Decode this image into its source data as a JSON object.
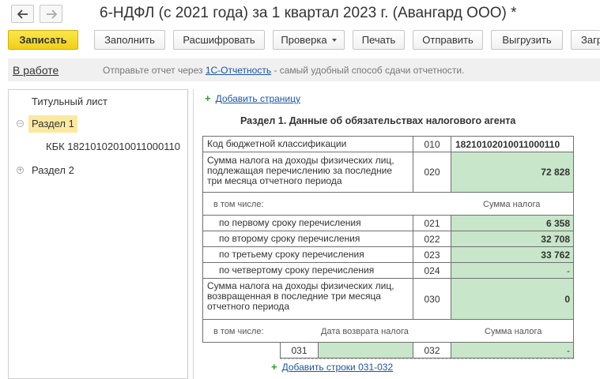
{
  "window": {
    "title": "6-НДФЛ (с 2021 года) за 1 квартал 2023 г. (Авангард ООО) *",
    "back_icon": "arrow-left-icon",
    "forward_icon": "arrow-right-icon"
  },
  "toolbar": {
    "save": "Записать",
    "fill": "Заполнить",
    "decode": "Расшифровать",
    "check": "Проверка",
    "print": "Печать",
    "send": "Отправить",
    "export": "Выгрузить",
    "load": "Загр"
  },
  "status": {
    "state": "В работе",
    "msg_before": "Отправьте отчет через ",
    "msg_link": "1С-Отчетность",
    "msg_after": " - самый удобный способ сдачи отчетности."
  },
  "tree": {
    "title_sheet": "Титульный лист",
    "section1": "Раздел 1",
    "kbk_item": "КБК 18210102010011000110",
    "section2": "Раздел 2"
  },
  "form": {
    "add_page": "Добавить страницу",
    "section_title": "Раздел 1. Данные об обязательствах налогового агента",
    "rows": {
      "kbk_label": "Код бюджетной классификации",
      "kbk_code": "010",
      "kbk_value": "18210102010011000110",
      "tax_label": "Сумма налога на доходы физических лиц, подлежащая перечислению за последние три месяца отчетного периода",
      "tax_code": "020",
      "tax_value": "72 828",
      "incl_label": "в том числе:",
      "incl_col": "Сумма налога",
      "r1_label": "по первому сроку перечисления",
      "r1_code": "021",
      "r1_value": "6 358",
      "r2_label": "по второму сроку перечисления",
      "r2_code": "022",
      "r2_value": "32 708",
      "r3_label": "по третьему сроку перечисления",
      "r3_code": "023",
      "r3_value": "33 762",
      "r4_label": "по четвертому сроку перечисления",
      "r4_code": "024",
      "r4_value": "-",
      "ret_label": "Сумма налога на доходы физических лиц, возвращенная в последние три месяца отчетного периода",
      "ret_code": "030",
      "ret_value": "0",
      "incl2_label": "в том числе:",
      "incl2_col1": "Дата возврата налога",
      "incl2_col2": "Сумма налога",
      "r031_code": "031",
      "r031_date": "",
      "r032_code": "032",
      "r032_value": "-"
    },
    "add_rows": "Добавить строки 031-032"
  },
  "colors": {
    "primary_button": "#f5d62a",
    "input_green": "#c8e6c9",
    "link": "#1b56a6",
    "selection": "#fbe9a0"
  }
}
